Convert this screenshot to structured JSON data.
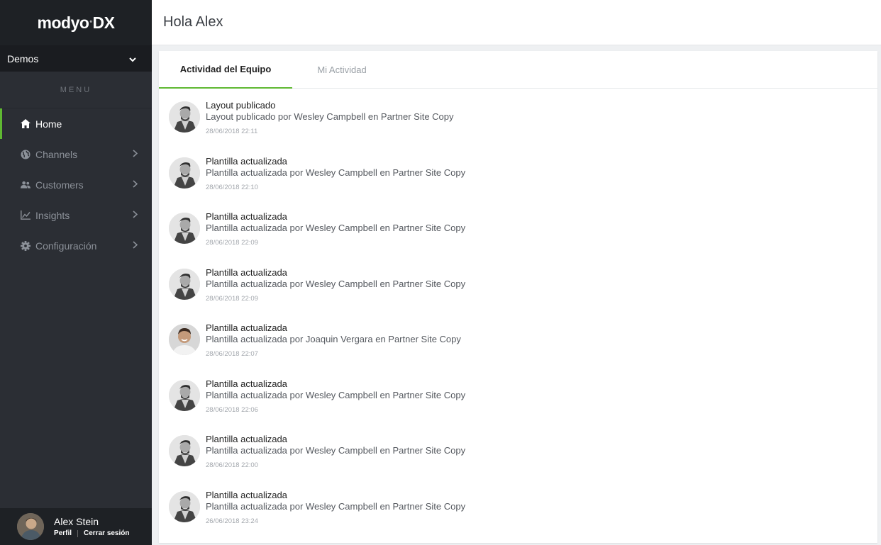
{
  "app": {
    "logo_main": "modyo",
    "logo_sup": "°",
    "logo_suffix": "DX"
  },
  "sidebar": {
    "site_select": "Demos",
    "menu_label": "MENU",
    "items": [
      {
        "label": "Home",
        "icon": "home-icon",
        "active": true
      },
      {
        "label": "Channels",
        "icon": "globe-icon"
      },
      {
        "label": "Customers",
        "icon": "users-icon"
      },
      {
        "label": "Insights",
        "icon": "chart-icon"
      },
      {
        "label": "Configuración",
        "icon": "gear-icon"
      }
    ],
    "user": {
      "name": "Alex Stein",
      "profile": "Perfil",
      "logout": "Cerrar sesión"
    }
  },
  "header": {
    "title": "Hola Alex"
  },
  "tabs": [
    {
      "label": "Actividad del Equipo",
      "active": true
    },
    {
      "label": "Mi Actividad",
      "active": false
    }
  ],
  "feed": [
    {
      "title": "Layout publicado",
      "desc": "Layout publicado por Wesley Campbell en Partner Site Copy",
      "time": "28/06/2018 22:11",
      "avatar": "wesley"
    },
    {
      "title": "Plantilla actualizada",
      "desc": "Plantilla actualizada por Wesley Campbell en Partner Site Copy",
      "time": "28/06/2018 22:10",
      "avatar": "wesley"
    },
    {
      "title": "Plantilla actualizada",
      "desc": "Plantilla actualizada por Wesley Campbell en Partner Site Copy",
      "time": "28/06/2018 22:09",
      "avatar": "wesley"
    },
    {
      "title": "Plantilla actualizada",
      "desc": "Plantilla actualizada por Wesley Campbell en Partner Site Copy",
      "time": "28/06/2018 22:09",
      "avatar": "wesley"
    },
    {
      "title": "Plantilla actualizada",
      "desc": "Plantilla actualizada por Joaquin Vergara en Partner Site Copy",
      "time": "28/06/2018 22:07",
      "avatar": "joaquin"
    },
    {
      "title": "Plantilla actualizada",
      "desc": "Plantilla actualizada por Wesley Campbell en Partner Site Copy",
      "time": "28/06/2018 22:06",
      "avatar": "wesley"
    },
    {
      "title": "Plantilla actualizada",
      "desc": "Plantilla actualizada por Wesley Campbell en Partner Site Copy",
      "time": "28/06/2018 22:00",
      "avatar": "wesley"
    },
    {
      "title": "Plantilla actualizada",
      "desc": "Plantilla actualizada por Wesley Campbell en Partner Site Copy",
      "time": "26/06/2018 23:24",
      "avatar": "wesley"
    }
  ],
  "colors": {
    "accent": "#5fb832",
    "sidebar_bg": "#2b2e34"
  }
}
